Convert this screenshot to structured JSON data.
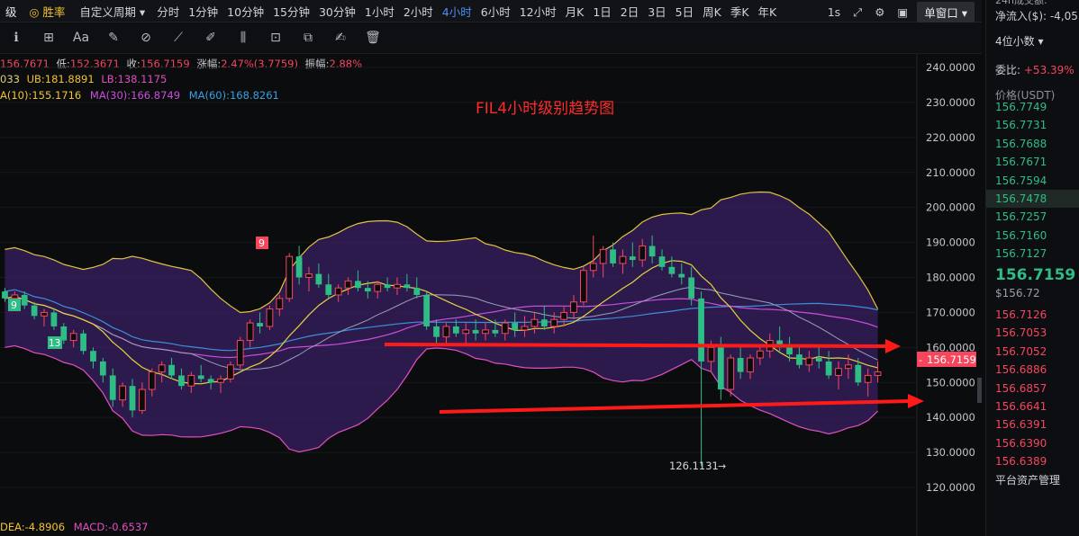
{
  "topbar": {
    "left_fragment": "级",
    "brand": "胜率",
    "custom_period": "自定义周期",
    "timeframes": [
      "分时",
      "1分钟",
      "10分钟",
      "15分钟",
      "30分钟",
      "1小时",
      "2小时",
      "4小时",
      "6小时",
      "12小时",
      "月K",
      "1日",
      "2日",
      "3日",
      "5日",
      "周K",
      "季K",
      "年K"
    ],
    "active_timeframe": "4小时",
    "interval_label": "1s",
    "window_mode": "单窗口"
  },
  "toolbar": {
    "icons": [
      "indicator-icon",
      "add-chart-icon",
      "text-font-icon",
      "brush-icon",
      "magnet-icon",
      "ruler-icon",
      "pencil-icon",
      "candle-type-icon",
      "lock-icon",
      "copy-icon",
      "edit-icon",
      "trash-icon"
    ],
    "font_label": "Aa"
  },
  "legend": {
    "ohlc": {
      "high_partial": "156.7671",
      "low_label": "低:",
      "low": "152.3671",
      "close_label": "收:",
      "close": "156.7159",
      "change_label": "涨幅:",
      "change": "2.47%(3.7759)",
      "amp_label": "振幅:",
      "amp": "2.88%"
    },
    "boll": {
      "mid_partial": "033",
      "ub_label": "UB:",
      "ub": "181.8891",
      "lb_label": "LB:",
      "lb": "138.1175"
    },
    "ma": {
      "ma10": "A(10):155.1716",
      "ma30": "MA(30):166.8749",
      "ma60": "MA(60):168.8261"
    },
    "macd": {
      "dea": "DEA:-4.8906",
      "macd": "MACD:-0.6537"
    }
  },
  "annotations": {
    "chart_title": "FIL4小时级别趋势图",
    "low_marker": "126.1131",
    "current_price_tag": "156.7159",
    "signal_tags": [
      "9",
      "9",
      "13"
    ]
  },
  "side_panel": {
    "top_cut": "24h成交额:",
    "net_inflow": "净流入($): -4,053",
    "decimals": "4位小数",
    "weibi_label": "委比:",
    "weibi_value": "+53.39%",
    "price_header": "价格(USDT)",
    "asks": [
      "156.7749",
      "156.7731",
      "156.7688",
      "156.7671",
      "156.7594",
      "156.7478",
      "156.7257",
      "156.7160",
      "156.7127"
    ],
    "last_price": "156.7159",
    "last_price_usd": "$156.72",
    "bids": [
      "156.7126",
      "156.7053",
      "156.7052",
      "156.6886",
      "156.6857",
      "156.6641",
      "156.6391",
      "156.6390",
      "156.6389"
    ],
    "footer": "平台资产管理"
  },
  "colors": {
    "up": "#2ebd85",
    "down": "#f6465d",
    "boll_band": "#3a1f63",
    "boll_line": "#e04fbf",
    "mid_line": "#d9d27a",
    "ma30": "#c94fd9",
    "ma60": "#3a8fd9",
    "accent": "#4d8df6",
    "arrow": "#ff1a1a"
  },
  "chart_data": {
    "type": "line",
    "title": "FIL4小时级别趋势图",
    "y_axis": {
      "ticks": [
        240,
        230,
        220,
        210,
        200,
        190,
        180,
        170,
        160,
        150,
        140,
        130,
        120
      ],
      "ylim": [
        117,
        243
      ]
    },
    "x_count": 96,
    "candles": [
      [
        176,
        177,
        173,
        174
      ],
      [
        174,
        176,
        172,
        175
      ],
      [
        175,
        176,
        171,
        172
      ],
      [
        172,
        173,
        168,
        169
      ],
      [
        169,
        171,
        166,
        170
      ],
      [
        170,
        171,
        165,
        166
      ],
      [
        166,
        167,
        161,
        162
      ],
      [
        162,
        165,
        160,
        164
      ],
      [
        164,
        165,
        158,
        159
      ],
      [
        159,
        160,
        154,
        156
      ],
      [
        156,
        157,
        150,
        152
      ],
      [
        152,
        154,
        143,
        145
      ],
      [
        145,
        150,
        143,
        149
      ],
      [
        149,
        151,
        140,
        142
      ],
      [
        142,
        150,
        141,
        148
      ],
      [
        148,
        154,
        146,
        153
      ],
      [
        153,
        156,
        150,
        155
      ],
      [
        155,
        157,
        151,
        152
      ],
      [
        152,
        154,
        148,
        149
      ],
      [
        149,
        153,
        147,
        152
      ],
      [
        152,
        155,
        150,
        151
      ],
      [
        151,
        152,
        148,
        150
      ],
      [
        150,
        152,
        147,
        151
      ],
      [
        151,
        156,
        150,
        155
      ],
      [
        155,
        163,
        154,
        162
      ],
      [
        162,
        168,
        160,
        167
      ],
      [
        167,
        170,
        164,
        166
      ],
      [
        166,
        172,
        165,
        171
      ],
      [
        171,
        175,
        169,
        174
      ],
      [
        174,
        187,
        173,
        186
      ],
      [
        186,
        189,
        178,
        180
      ],
      [
        180,
        183,
        176,
        181
      ],
      [
        181,
        184,
        177,
        178
      ],
      [
        178,
        181,
        174,
        175
      ],
      [
        175,
        178,
        173,
        177
      ],
      [
        177,
        180,
        175,
        179
      ],
      [
        179,
        182,
        176,
        177
      ],
      [
        177,
        179,
        174,
        176
      ],
      [
        176,
        179,
        174,
        178
      ],
      [
        178,
        180,
        176,
        177
      ],
      [
        177,
        180,
        175,
        178
      ],
      [
        178,
        181,
        176,
        177
      ],
      [
        177,
        180,
        174,
        175
      ],
      [
        175,
        176,
        165,
        166
      ],
      [
        166,
        168,
        161,
        163
      ],
      [
        163,
        167,
        161,
        166
      ],
      [
        166,
        168,
        163,
        164
      ],
      [
        164,
        167,
        161,
        165
      ],
      [
        165,
        168,
        162,
        164
      ],
      [
        164,
        167,
        162,
        165
      ],
      [
        165,
        168,
        163,
        164
      ],
      [
        164,
        168,
        162,
        167
      ],
      [
        167,
        170,
        163,
        165
      ],
      [
        165,
        169,
        163,
        166
      ],
      [
        166,
        170,
        164,
        168
      ],
      [
        168,
        172,
        165,
        166
      ],
      [
        166,
        170,
        164,
        168
      ],
      [
        168,
        172,
        166,
        170
      ],
      [
        170,
        175,
        168,
        173
      ],
      [
        173,
        183,
        172,
        182
      ],
      [
        182,
        192,
        180,
        184
      ],
      [
        184,
        189,
        180,
        188
      ],
      [
        188,
        190,
        183,
        184
      ],
      [
        184,
        188,
        181,
        186
      ],
      [
        186,
        190,
        183,
        185
      ],
      [
        185,
        191,
        183,
        189
      ],
      [
        189,
        192,
        184,
        186
      ],
      [
        186,
        188,
        182,
        183
      ],
      [
        183,
        186,
        180,
        181
      ],
      [
        181,
        184,
        178,
        180
      ],
      [
        180,
        183,
        172,
        174
      ],
      [
        174,
        176,
        155,
        156
      ],
      [
        156,
        162,
        153,
        160
      ],
      [
        160,
        163,
        145,
        148
      ],
      [
        148,
        158,
        146,
        157
      ],
      [
        157,
        160,
        151,
        153
      ],
      [
        153,
        158,
        151,
        157
      ],
      [
        157,
        161,
        155,
        159
      ],
      [
        159,
        164,
        157,
        162
      ],
      [
        162,
        166,
        159,
        160
      ],
      [
        160,
        163,
        156,
        158
      ],
      [
        158,
        161,
        154,
        155
      ],
      [
        155,
        159,
        153,
        157
      ],
      [
        157,
        160,
        154,
        156
      ],
      [
        156,
        159,
        151,
        152
      ],
      [
        152,
        156,
        148,
        154
      ],
      [
        154,
        158,
        151,
        155
      ],
      [
        155,
        157,
        149,
        150
      ],
      [
        150,
        154,
        146,
        152
      ],
      [
        152,
        156,
        150,
        153
      ]
    ]
  }
}
